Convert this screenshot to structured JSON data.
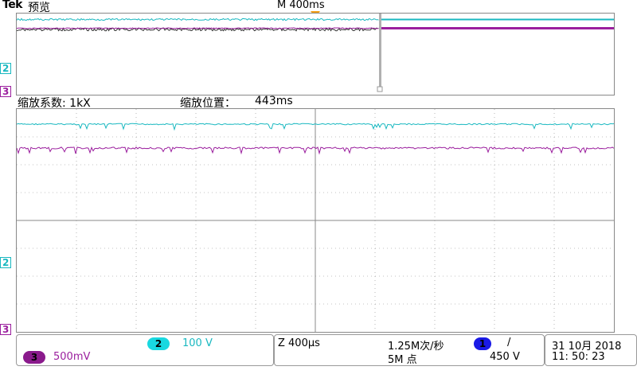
{
  "header": {
    "brand": "Tek",
    "mode": "预览",
    "timebase": "M 400ms"
  },
  "zoom": {
    "factor_label": "缩放系数: 1kX",
    "position_label": "缩放位置：",
    "position_value": "443ms"
  },
  "markers": {
    "ch2": "2",
    "ch3": "3"
  },
  "channels": {
    "ch2": {
      "label": "2",
      "scale": "100 V",
      "color": "#19b8c0"
    },
    "ch3": {
      "label": "3",
      "scale": "500mV",
      "color": "#9b1f9e"
    }
  },
  "acquisition": {
    "zoom_time": "Z 400µs",
    "sample_rate": "1.25M次/秒",
    "record_length": "5M 点"
  },
  "trigger": {
    "source": "1",
    "slope": "/",
    "level": "450 V",
    "color": "#1a1ae6"
  },
  "datetime": {
    "date": "31 10月 2018",
    "time": "11: 50: 23"
  }
}
